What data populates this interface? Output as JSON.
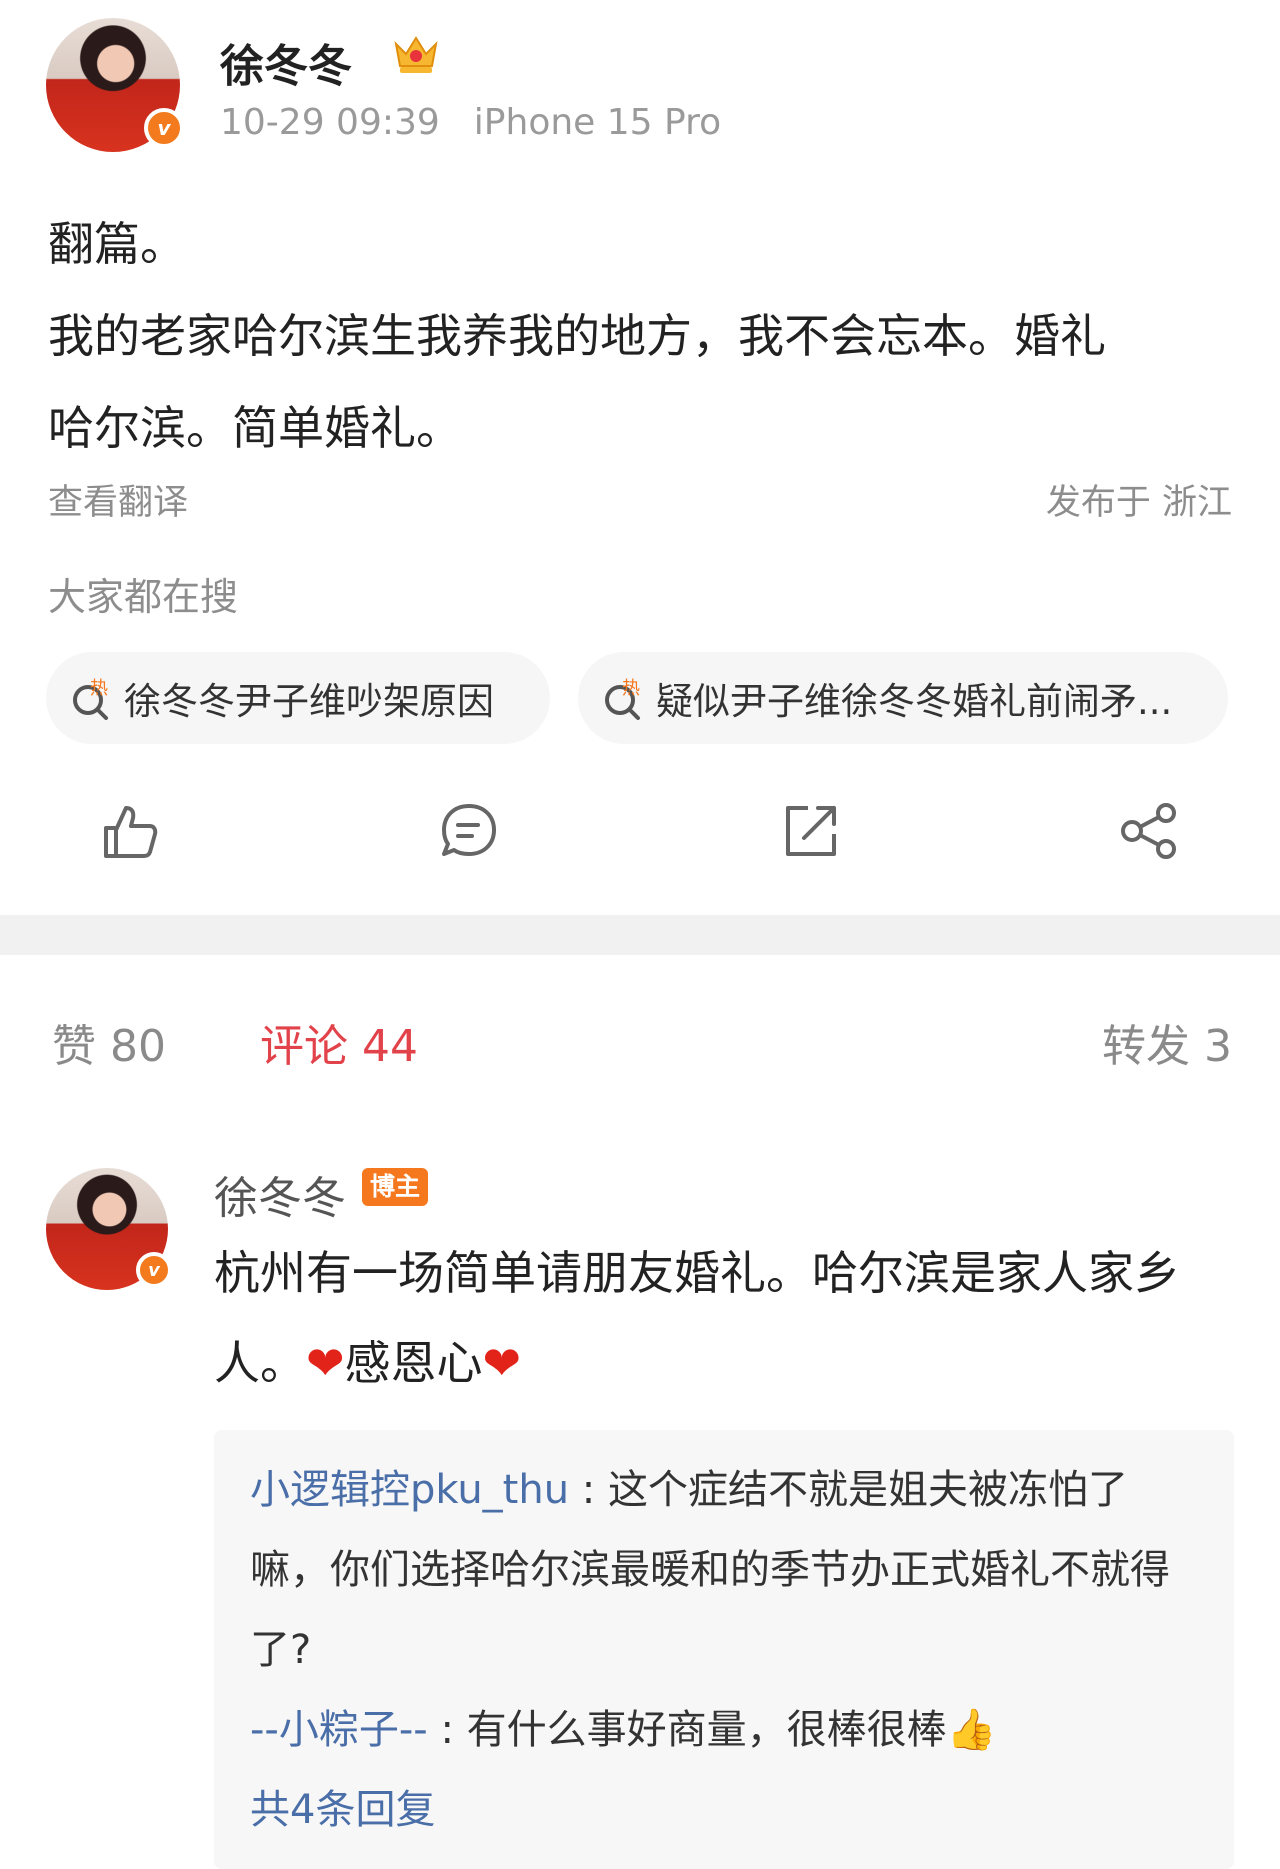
{
  "post": {
    "author": "徐冬冬",
    "time": "10-29 09:39",
    "device": "iPhone 15 Pro",
    "text_line1": "翻篇。",
    "text_line2": "我的老家哈尔滨生我养我的地方，我不会忘本。婚礼",
    "text_line3": "哈尔滨。简单婚礼。",
    "translate": "查看翻译",
    "location": "发布于 浙江"
  },
  "trending": {
    "label": "大家都在搜",
    "items": [
      {
        "text": "徐冬冬尹子维吵架原因",
        "badge": "热"
      },
      {
        "text": "疑似尹子维徐冬冬婚礼前闹矛...",
        "badge": "热"
      }
    ]
  },
  "actions": {
    "like": "like-icon",
    "comment": "comment-icon",
    "repost": "repost-icon",
    "share": "share-icon"
  },
  "stats": {
    "likes": "赞 80",
    "comments": "评论 44",
    "reposts": "转发 3"
  },
  "comment": {
    "author": "徐冬冬",
    "tag": "博主",
    "text_part1": "杭州有一场简单请朋友婚礼。哈尔滨是家人家",
    "text_part2": "乡人。",
    "text_part3": "感恩心",
    "replies": [
      {
        "user": "小逻辑控pku_thu",
        "text": "这个症结不就是姐夫被冻怕了嘛，你们选择哈尔滨最暖和的季节办正式婚礼不就得了?"
      },
      {
        "user": "--小粽子--",
        "text": "有什么事好商量，很棒很棒"
      }
    ],
    "reply_count": "共4条回复"
  },
  "colors": {
    "accent_red": "#e2434a",
    "link_blue": "#4a6ea8",
    "badge_orange": "#f5781f"
  }
}
